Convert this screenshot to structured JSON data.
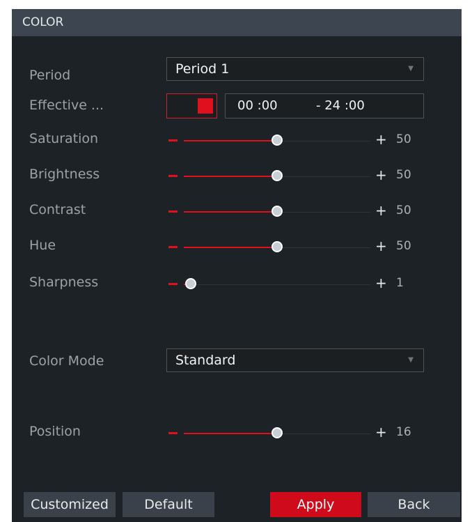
{
  "title": "COLOR",
  "period": {
    "label": "Period",
    "value": "Period 1"
  },
  "effective": {
    "label": "Effective ...",
    "enabled": true,
    "start": "00 :00",
    "end": "- 24 :00"
  },
  "sliders": [
    {
      "label": "Saturation",
      "value": "50",
      "fraction": 0.5
    },
    {
      "label": "Brightness",
      "value": "50",
      "fraction": 0.5
    },
    {
      "label": "Contrast",
      "value": "50",
      "fraction": 0.5
    },
    {
      "label": "Hue",
      "value": "50",
      "fraction": 0.5
    },
    {
      "label": "Sharpness",
      "value": "1",
      "fraction": 0.0
    }
  ],
  "color_mode": {
    "label": "Color Mode",
    "value": "Standard"
  },
  "position": {
    "label": "Position",
    "value": "16",
    "fraction": 0.5
  },
  "buttons": {
    "customized": "Customized",
    "default": "Default",
    "apply": "Apply",
    "back": "Back"
  },
  "colors": {
    "accent": "#e0101f",
    "panel": "#1d2226",
    "titlebar": "#3c4550",
    "button": "#3a414a"
  }
}
